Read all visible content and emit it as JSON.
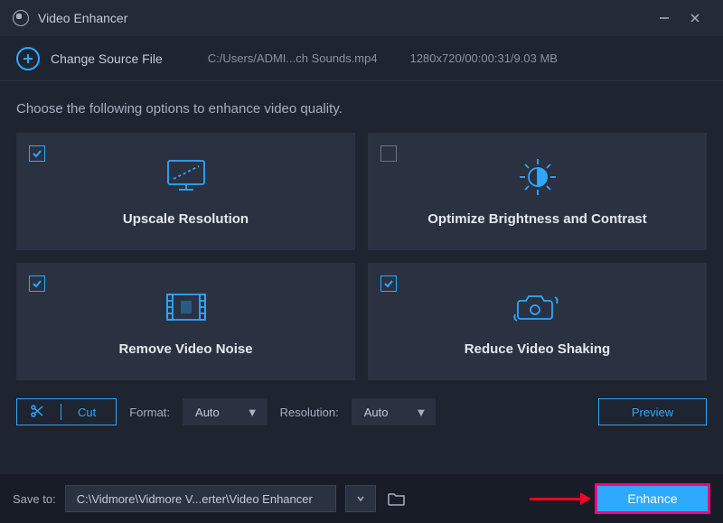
{
  "window": {
    "title": "Video Enhancer"
  },
  "source": {
    "change_label": "Change Source File",
    "path": "C:/Users/ADMI...ch Sounds.mp4",
    "meta": "1280x720/00:00:31/9.03 MB"
  },
  "heading": "Choose the following options to enhance video quality.",
  "cards": [
    {
      "label": "Upscale Resolution",
      "checked": true
    },
    {
      "label": "Optimize Brightness and Contrast",
      "checked": false
    },
    {
      "label": "Remove Video Noise",
      "checked": true
    },
    {
      "label": "Reduce Video Shaking",
      "checked": true
    }
  ],
  "controls": {
    "cut_label": "Cut",
    "format_label": "Format:",
    "format_value": "Auto",
    "resolution_label": "Resolution:",
    "resolution_value": "Auto",
    "preview_label": "Preview"
  },
  "footer": {
    "save_label": "Save to:",
    "save_path": "C:\\Vidmore\\Vidmore V...erter\\Video Enhancer",
    "enhance_label": "Enhance"
  }
}
